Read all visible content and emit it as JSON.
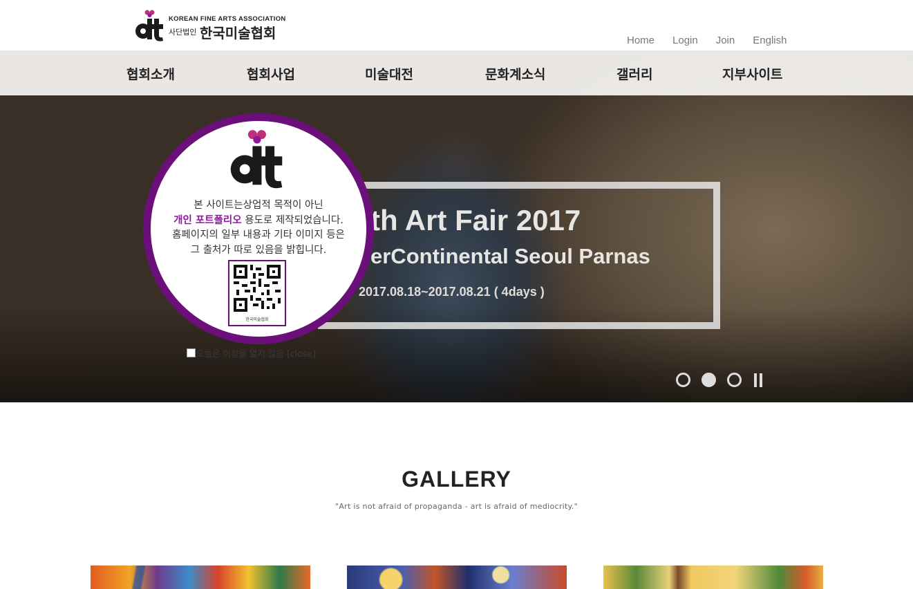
{
  "header": {
    "logo": {
      "english": "KOREAN FINE ARTS ASSOCIATION",
      "korean_prefix": "사단법인",
      "korean_name": "한국미술협회"
    },
    "util_nav": [
      "Home",
      "Login",
      "Join",
      "English"
    ]
  },
  "main_nav": [
    "협회소개",
    "협회사업",
    "미술대전",
    "문화계소식",
    "갤러리",
    "지부사이트"
  ],
  "hero": {
    "title": "th Art Fair 2017",
    "venue": "erContinental Seoul Parnas",
    "dates": "2017.08.18~2017.08.21 ( 4days )",
    "slider": {
      "slide_count": 3,
      "active_index": 1,
      "pause_icon": "pause-icon"
    }
  },
  "popup": {
    "line1": "본 사이트는상업적 목적이 아닌",
    "line2_highlight": "개인 포트폴리오",
    "line2_rest": " 용도로 제작되었습니다.",
    "line3": "홈페이지의 일부 내용과 기타 이미지 등은",
    "line4": "그 출처가 따로 있음을 밝힙니다.",
    "qr_caption": "한국미술협회",
    "close_label": "오늘은 이창을 열지 않음 [close]"
  },
  "gallery": {
    "title": "GALLERY",
    "quote": "\"Art is not afraid of propaganda - art is afraid of mediocrity.\""
  },
  "colors": {
    "brand_purple": "#6b0f7a",
    "highlight_purple": "#8b1a9a",
    "logo_pink": "#c0307a"
  }
}
